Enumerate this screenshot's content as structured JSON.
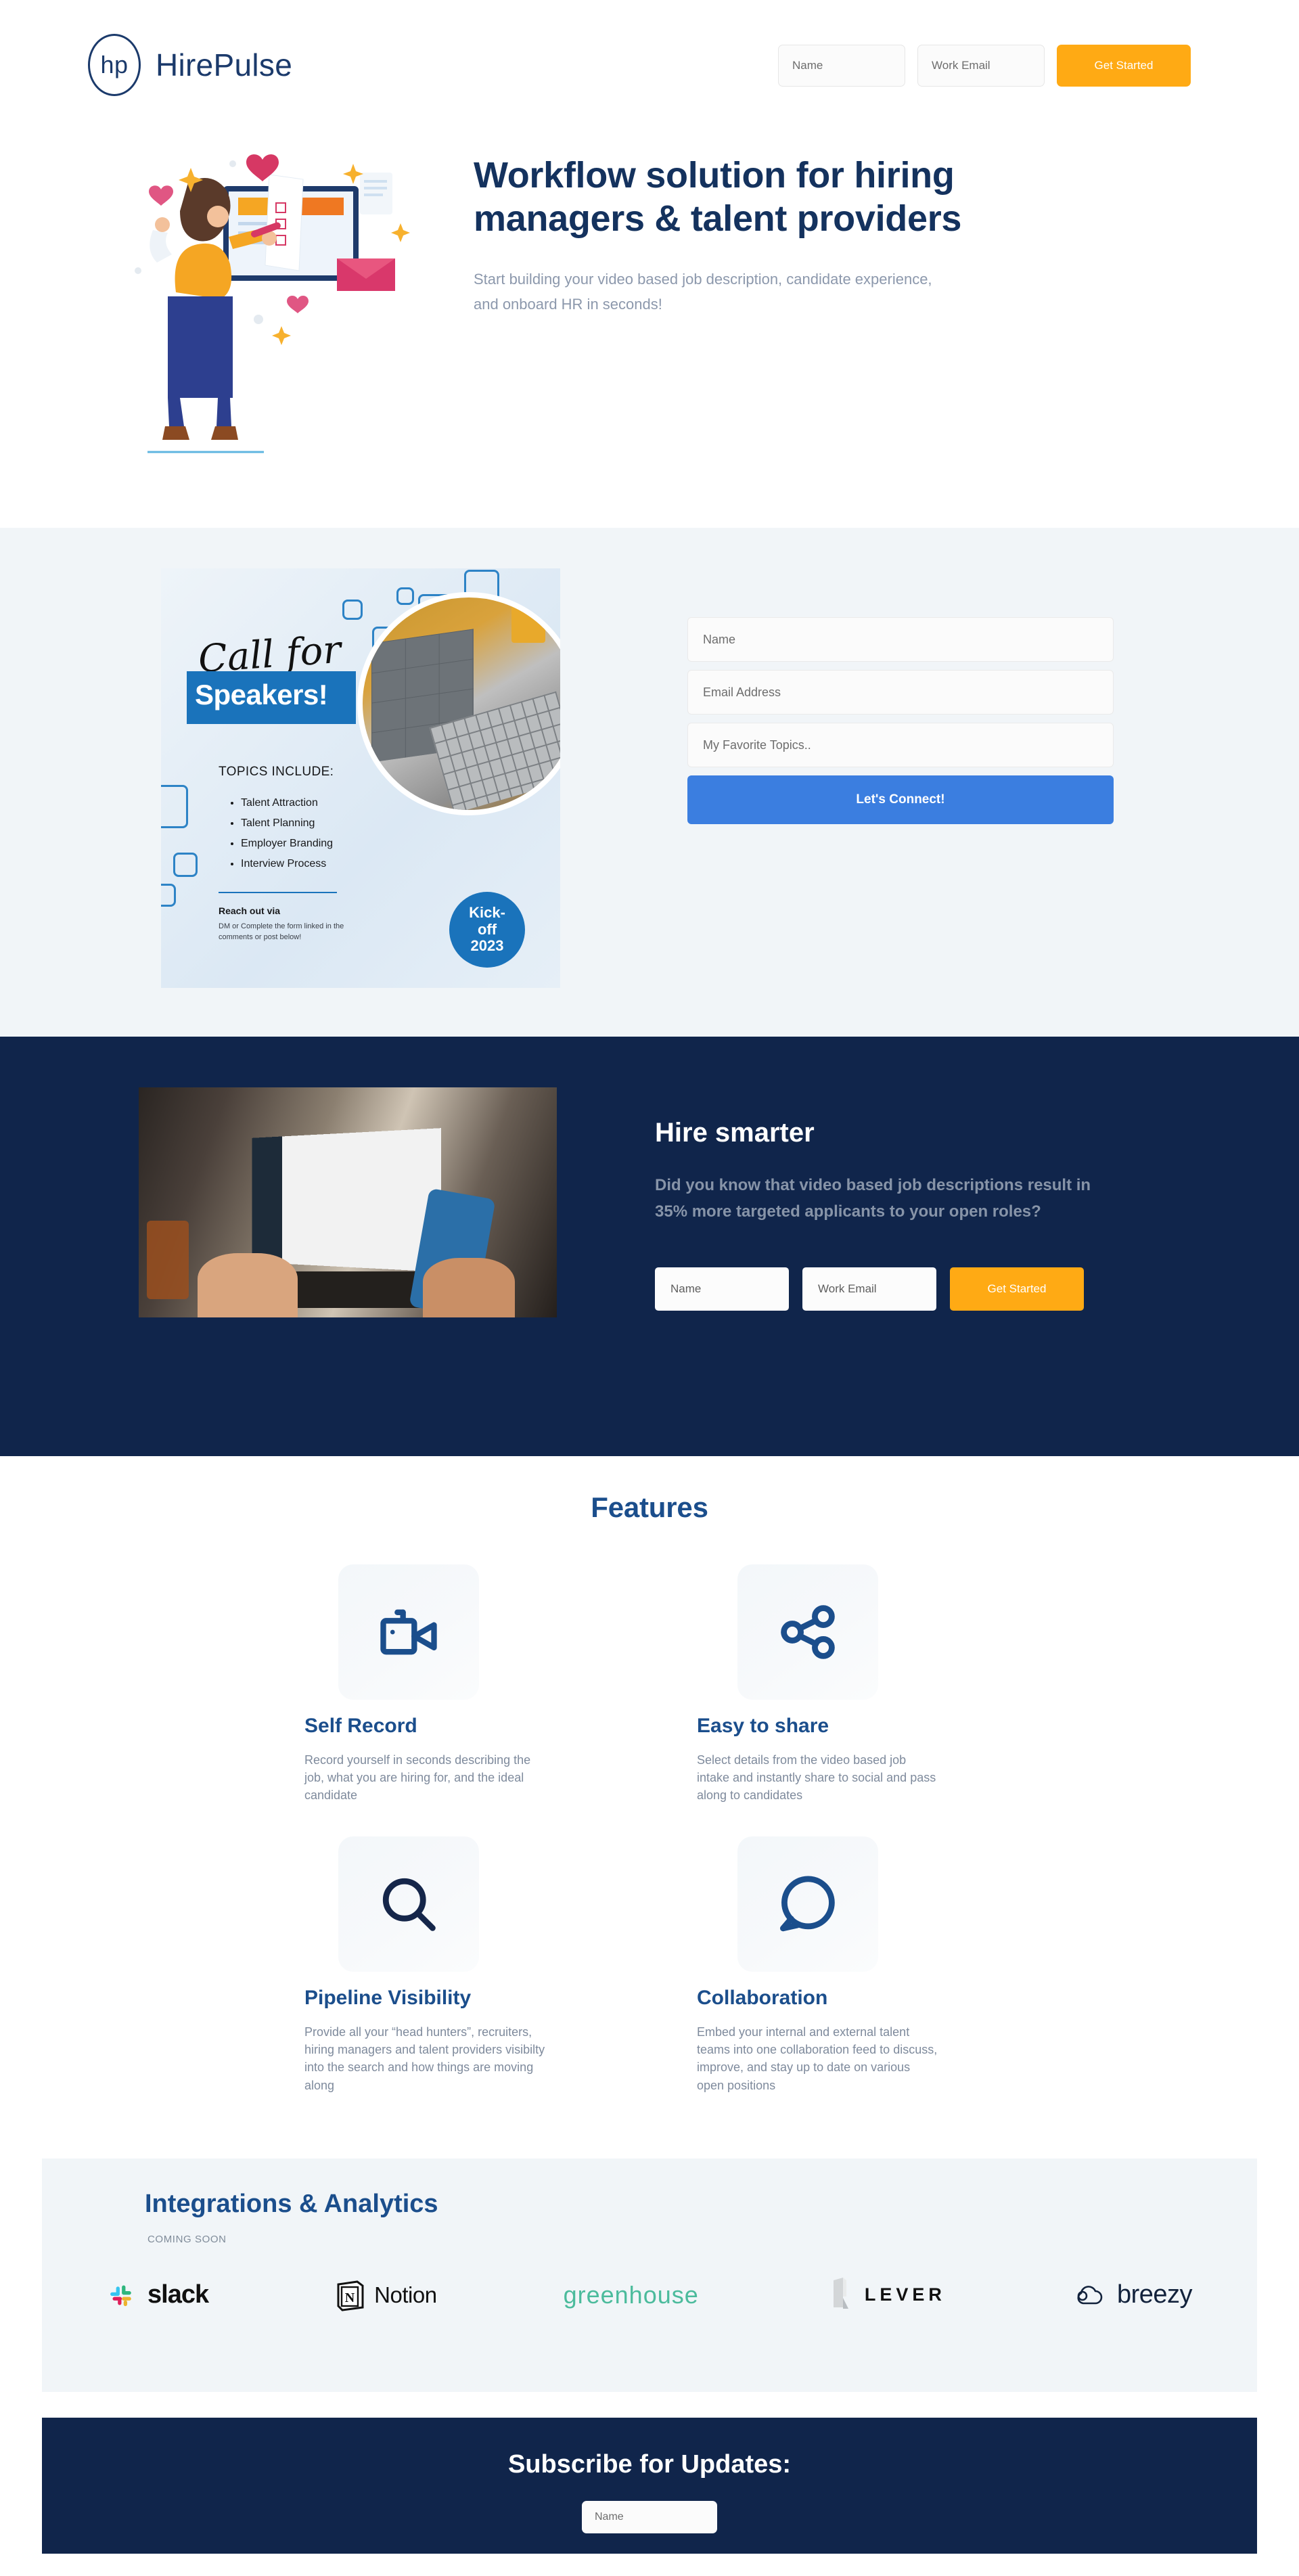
{
  "brand": {
    "mark": "hp",
    "name": "HirePulse"
  },
  "header": {
    "name_placeholder": "Name",
    "email_placeholder": "Work Email",
    "cta_label": "Get Started"
  },
  "hero": {
    "title": "Workflow solution for hiring managers & talent providers",
    "subtitle": "Start building your video based job description, candidate experience, and onboard HR in seconds!"
  },
  "speakers": {
    "poster": {
      "script_line": "Call for",
      "headline": "Speakers!",
      "topics_label": "TOPICS INCLUDE:",
      "topics": [
        "Talent Attraction",
        "Talent Planning",
        "Employer Branding",
        "Interview Process"
      ],
      "reach_out": "Reach out via",
      "reach_detail": "DM or Complete the form linked in the comments or post below!",
      "badge_line1": "Kick-",
      "badge_line2": "off",
      "badge_line3": "2023"
    },
    "form": {
      "name_placeholder": "Name",
      "email_placeholder": "Email Address",
      "topics_placeholder": "My Favorite Topics..",
      "submit_label": "Let's Connect!"
    }
  },
  "smarter": {
    "title": "Hire smarter",
    "body": "Did you know that video based job descriptions result in 35% more targeted applicants to your open roles?",
    "name_placeholder": "Name",
    "email_placeholder": "Work Email",
    "cta_label": "Get Started"
  },
  "features": {
    "title": "Features",
    "items": [
      {
        "icon": "video-camera-icon",
        "title": "Self Record",
        "desc": "Record yourself in seconds describing the job, what you are hiring for, and the ideal candidate"
      },
      {
        "icon": "share-nodes-icon",
        "title": "Easy to share",
        "desc": "Select details from the video based job intake and instantly share to social and pass along to candidates"
      },
      {
        "icon": "magnifier-icon",
        "title": "Pipeline Visibility",
        "desc": "Provide all your “head hunters”, recruiters, hiring managers and talent providers visibilty into the search and how things are moving along"
      },
      {
        "icon": "chat-bubble-icon",
        "title": "Collaboration",
        "desc": "Embed your internal and external talent teams into one collaboration feed to discuss, improve, and stay up to date on various open positions"
      }
    ]
  },
  "integrations": {
    "title": "Integrations & Analytics",
    "coming_soon": "COMING SOON",
    "logos": [
      {
        "name": "slack",
        "label": "slack"
      },
      {
        "name": "notion",
        "label": "Notion"
      },
      {
        "name": "greenhouse",
        "label": "greenhouse"
      },
      {
        "name": "lever",
        "label": "LEVER"
      },
      {
        "name": "breezy",
        "label": "breezy"
      }
    ]
  },
  "footer": {
    "title": "Subscribe for Updates:",
    "name_placeholder": "Name"
  },
  "colors": {
    "navy": "#10254b",
    "brand_blue": "#1b4e8c",
    "accent_orange": "#ffaa14",
    "accent_blue": "#3b7ee0",
    "light_bg": "#f1f5f8",
    "muted_text": "#8c98ac"
  }
}
